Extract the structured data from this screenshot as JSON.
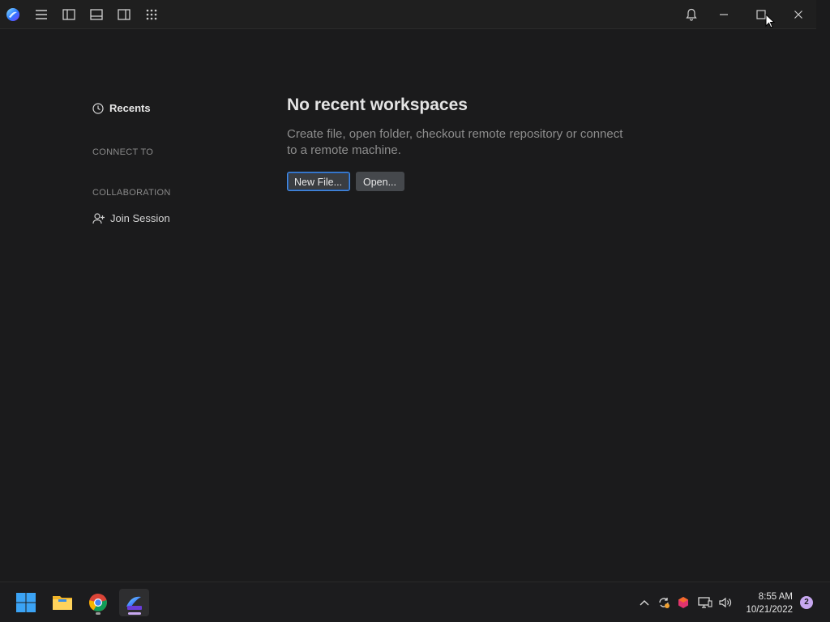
{
  "titlebar": {
    "icons": [
      "app-logo",
      "menu-icon",
      "left-panel-icon",
      "bottom-panel-icon",
      "right-panel-icon",
      "apps-grid-icon",
      "bell-icon",
      "minimize-icon",
      "maximize-icon",
      "close-icon"
    ]
  },
  "sidebar": {
    "recents_label": "Recents",
    "connect_to_label": "CONNECT TO",
    "collaboration_label": "COLLABORATION",
    "join_session_label": "Join Session"
  },
  "main": {
    "heading": "No recent workspaces",
    "description": "Create file, open folder, checkout remote repository or connect to a remote machine.",
    "new_file_button": "New File...",
    "open_button": "Open..."
  },
  "taskbar": {
    "apps": [
      "windows-start-icon",
      "file-explorer-icon",
      "chrome-icon",
      "fleet-icon"
    ],
    "time": "8:55 AM",
    "date": "10/21/2022",
    "notification_count": "2"
  },
  "colors": {
    "background": "#1b1b1c",
    "accent_border": "#4a8ce0",
    "badge": "#c7a7f0"
  }
}
